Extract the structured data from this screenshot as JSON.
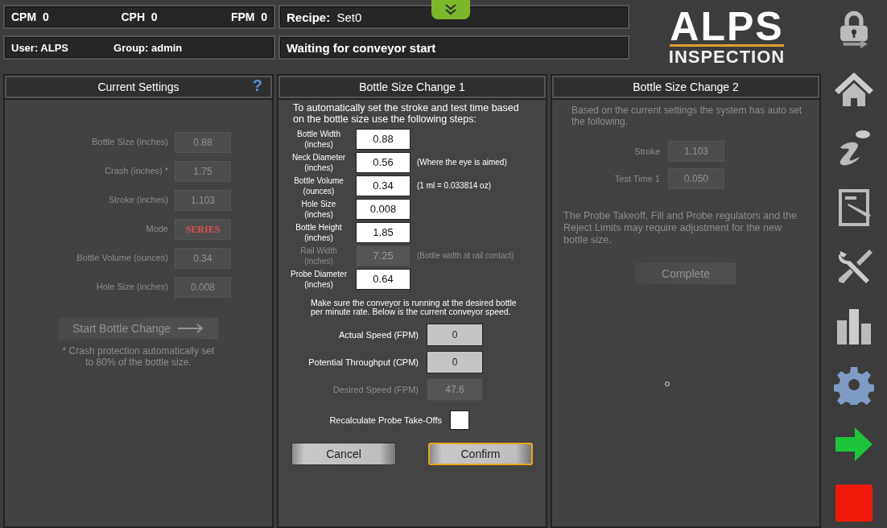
{
  "header": {
    "counters": [
      {
        "label": "CPM",
        "value": "0"
      },
      {
        "label": "CPH",
        "value": "0"
      },
      {
        "label": "FPM",
        "value": "0"
      }
    ],
    "recipe": {
      "label": "Recipe:",
      "value": "Set0"
    },
    "user": {
      "label": "User:",
      "value": "ALPS"
    },
    "group": {
      "label": "Group:",
      "value": "admin"
    },
    "status": "Waiting for conveyor start",
    "logo": {
      "top": "ALPS",
      "bottom": "INSPECTION"
    }
  },
  "current_settings": {
    "title": "Current Settings",
    "help": "?",
    "disabled": true,
    "fields": [
      {
        "label": "Bottle Size (inches)",
        "value": "0.88",
        "kind": "number"
      },
      {
        "label": "Crash (inches) *",
        "value": "1.75",
        "kind": "number"
      },
      {
        "label": "Stroke (inches)",
        "value": "1.103",
        "kind": "number"
      },
      {
        "label": "Mode",
        "value": "SERIES",
        "kind": "alert"
      },
      {
        "label": "Bottle Volume (ounces)",
        "value": "0.34",
        "kind": "number"
      },
      {
        "label": "Hole Size (inches)",
        "value": "0.008",
        "kind": "number"
      }
    ],
    "button": "Start Bottle Change",
    "note": "* Crash protection automatically set to 80% of the bottle size."
  },
  "bottle_size_change_1": {
    "title": "Bottle Size Change 1",
    "intro": "To automatically set the stroke and test time based on the bottle size use the following steps:",
    "fields": [
      {
        "label": "Bottle Width",
        "unit": "(inches)",
        "value": "0.88",
        "disabled": false
      },
      {
        "label": "Neck Diameter",
        "unit": "(inches)",
        "value": "0.56",
        "note": "(Where the eye is aimed)",
        "disabled": false
      },
      {
        "label": "Bottle Volume",
        "unit": "(ounces)",
        "value": "0.34",
        "note": "(1 ml = 0.033814 oz)",
        "disabled": false
      },
      {
        "label": "Hole Size",
        "unit": "(inches)",
        "value": "0.008",
        "disabled": false
      },
      {
        "label": "Bottle Height",
        "unit": "(inches)",
        "value": "1.85",
        "disabled": false
      },
      {
        "label": "Rail Width",
        "unit": "(inches)",
        "value": "7.25",
        "note": "(Bottle width at rail contact)",
        "disabled": true
      },
      {
        "label": "Probe Diameter",
        "unit": "(inches)",
        "value": "0.64",
        "disabled": false
      }
    ],
    "speed_note": "Make sure the conveyor is running at the desired bottle per minute rate.  Below is the current conveyor speed.",
    "speeds": [
      {
        "label": "Actual Speed (FPM)",
        "value": "0",
        "disabled": false
      },
      {
        "label": "Potential Throughput (CPM)",
        "value": "0",
        "disabled": false
      },
      {
        "label": "Desired Speed (FPM)",
        "value": "47.6",
        "disabled": true
      }
    ],
    "recalculate": {
      "label": "Recalculate Probe Take-Offs",
      "checked": false
    },
    "buttons": [
      {
        "label": "Cancel",
        "focused": false
      },
      {
        "label": "Confirm",
        "focused": true
      }
    ]
  },
  "bottle_size_change_2": {
    "title": "Bottle Size Change 2",
    "disabled": true,
    "intro": "Based on the current settings the system has auto set the following.",
    "fields": [
      {
        "label": "Stroke",
        "value": "1.103"
      },
      {
        "label": "Test Time 1",
        "value": "0.050"
      }
    ],
    "note": "The Probe Takeoff, Fill and Probe regulators and the Reject Limits may require adjustment for the new bottle size.",
    "button": "Complete"
  }
}
